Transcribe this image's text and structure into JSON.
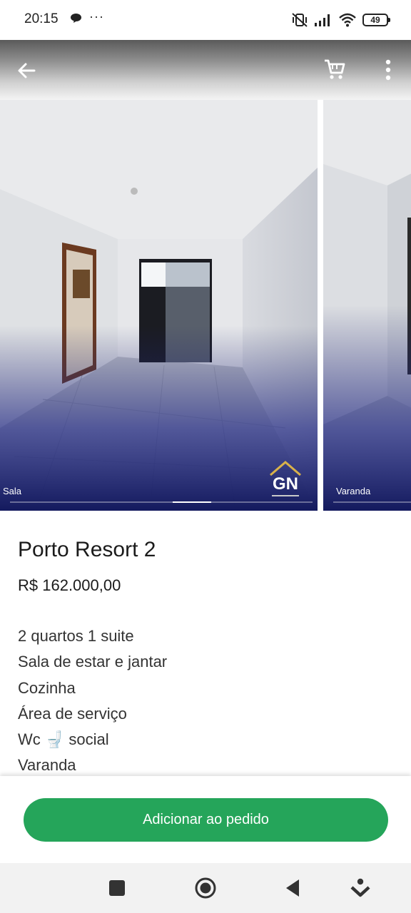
{
  "status_bar": {
    "time": "20:15",
    "battery": "49",
    "icons": [
      "chat-bubble-icon",
      "more-dots-icon",
      "vibrate-off-icon",
      "signal-icon",
      "wifi-icon",
      "battery-icon"
    ],
    "dots": "···"
  },
  "header": {
    "icons": [
      "back-arrow-icon",
      "shopping-cart-icon",
      "more-vert-icon"
    ]
  },
  "gallery": {
    "slides": [
      {
        "caption": "Sala"
      },
      {
        "caption": "Varanda"
      }
    ],
    "current_slide": 1,
    "slide_count": 8,
    "logo_text": "GN"
  },
  "product": {
    "title": "Porto Resort 2",
    "price": "R$ 162.000,00",
    "description": [
      "2 quartos 1 suite",
      "Sala de estar e jantar",
      "Cozinha",
      "Área de serviço",
      "Wc 🚽 social",
      "Varanda"
    ]
  },
  "action": {
    "add_label": "Adicionar ao pedido",
    "color": "#25a55a"
  },
  "nav_bar": {
    "icons": [
      "square-icon",
      "circle-home-icon",
      "back-triangle-icon",
      "assistant-icon"
    ]
  }
}
